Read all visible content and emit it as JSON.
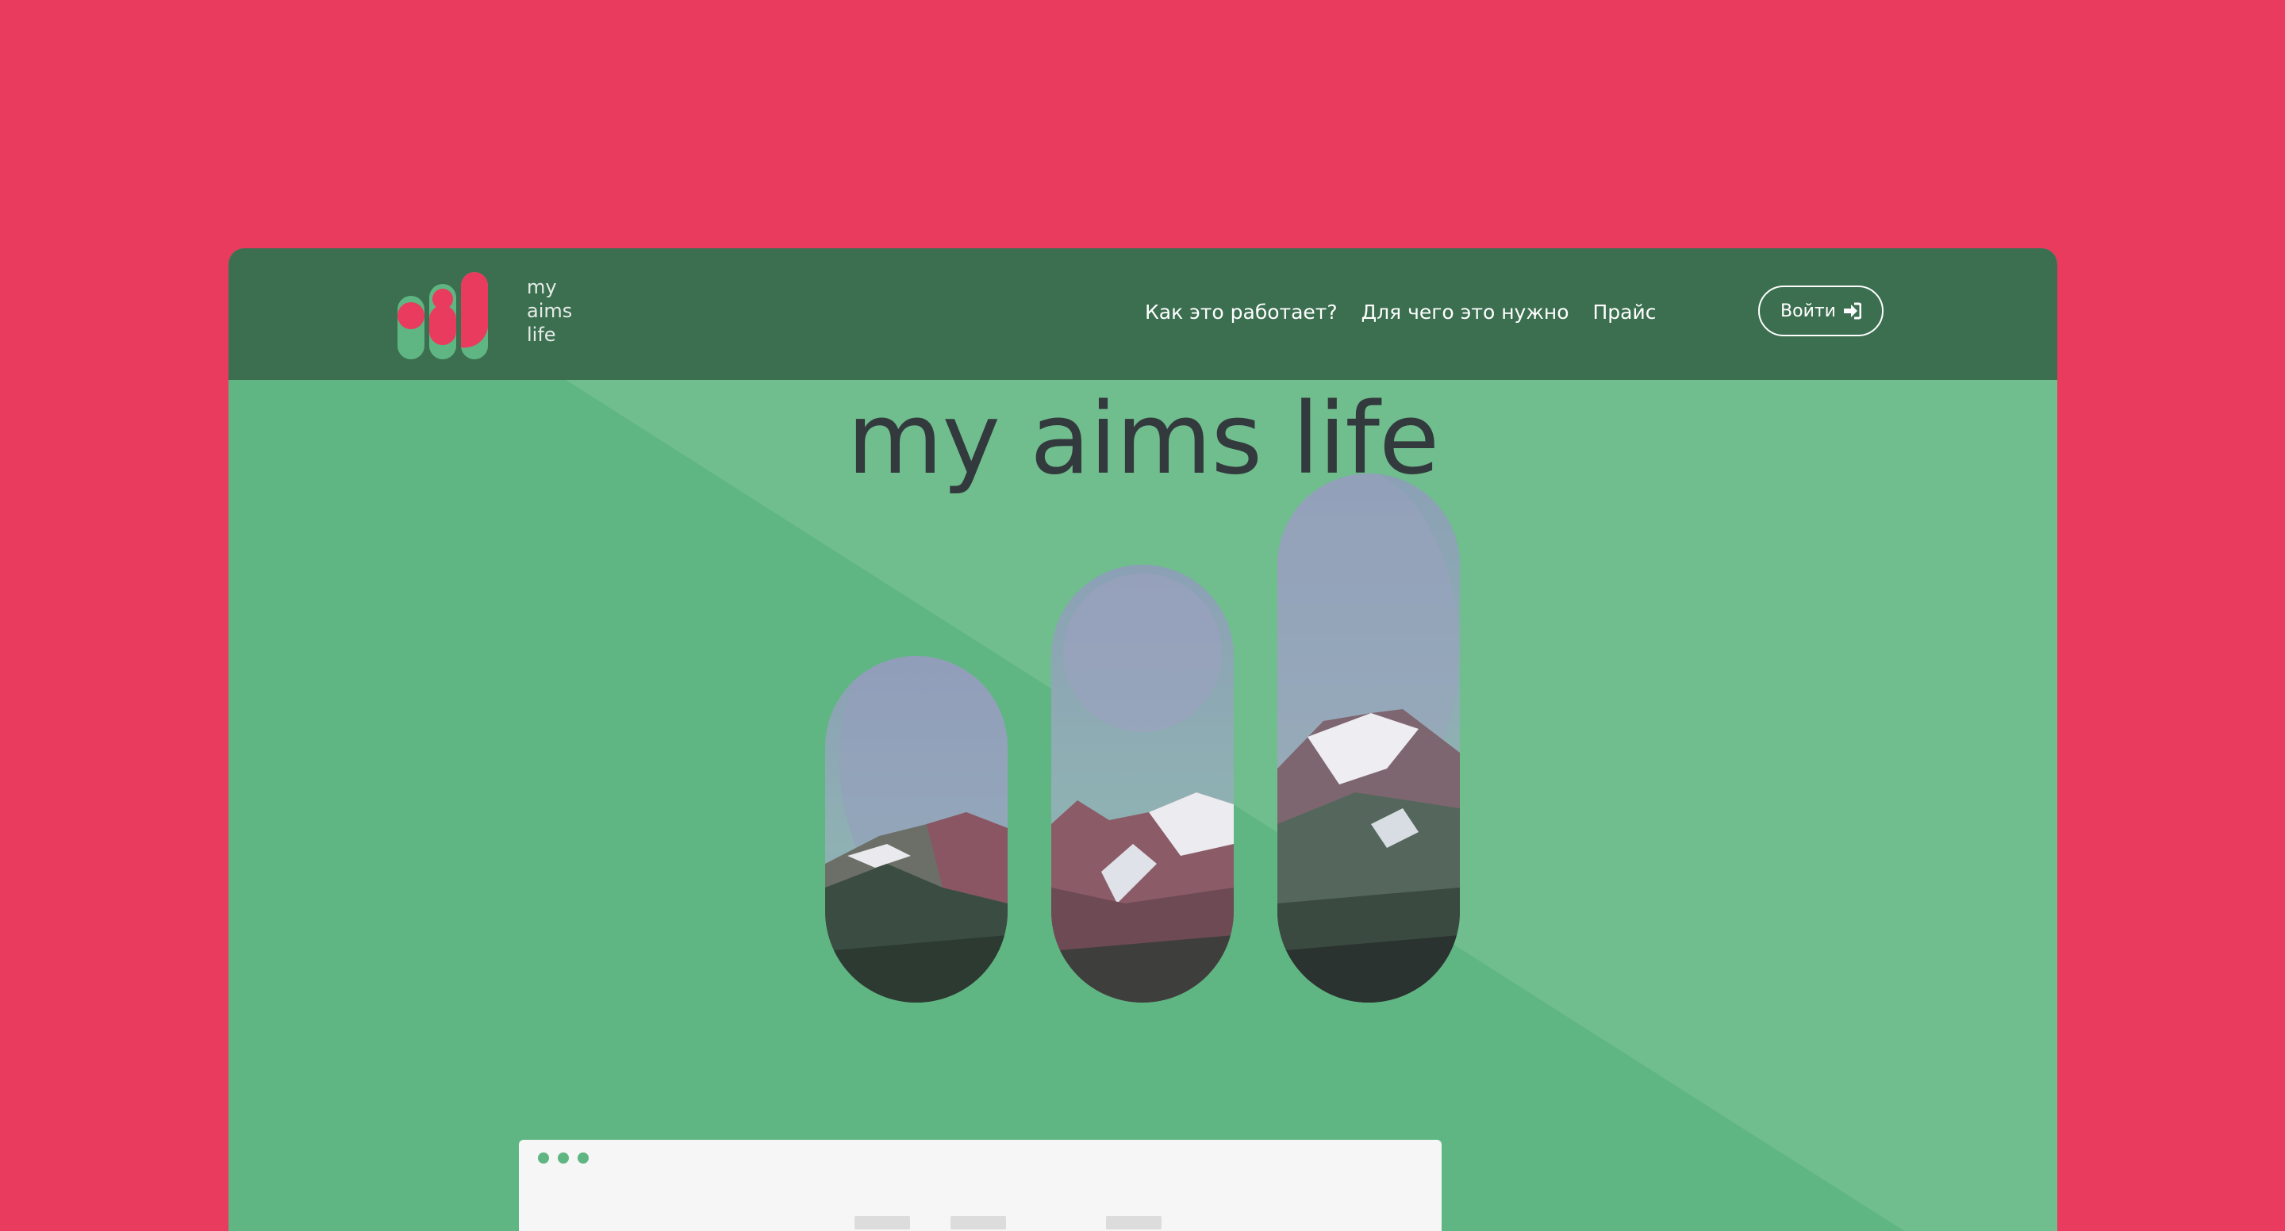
{
  "colors": {
    "page_bg": "#e93b5e",
    "header_bg": "#3b6f50",
    "hero_bg": "#5fb682",
    "hero_bg_light": "#70bd8e",
    "accent_red": "#e93b5e",
    "text_dark": "#333a3d"
  },
  "header": {
    "logo_lines": [
      "my",
      "aims",
      "life"
    ],
    "nav": [
      {
        "label": "Как это работает?"
      },
      {
        "label": "Для чего это нужно"
      },
      {
        "label": "Прайс"
      }
    ],
    "login_label": "Войти",
    "login_icon": "sign-in-icon"
  },
  "hero": {
    "title": "my aims life",
    "image_subject": "mountain peaks",
    "pill_count": 3
  },
  "preview_card": {
    "dots": 3,
    "dot_icon": "window-control-dots"
  }
}
